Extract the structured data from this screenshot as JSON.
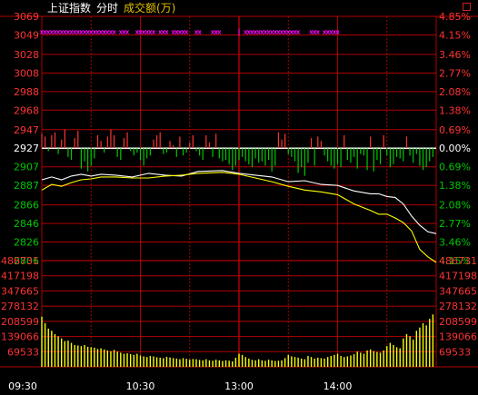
{
  "header": {
    "title": "上证指数",
    "mode": "分时",
    "series_label": "成交额(万)"
  },
  "colors": {
    "background": "#000000",
    "grid": "#b00000",
    "up": "#ff3333",
    "down": "#00c800",
    "neutral": "#ffffff",
    "index_line": "#ffffff",
    "average_line": "#ffff00",
    "volume": "#ffff00",
    "markers": "#ff00ff",
    "header_accent": "#e0c000"
  },
  "chart_data": {
    "type": "line",
    "title": "上证指数 分时",
    "ylabel_left": [
      "3069",
      "3049",
      "3028",
      "3008",
      "2988",
      "2968",
      "2947",
      "2927",
      "2907",
      "2887",
      "2866",
      "2846",
      "2826",
      "2806",
      "486731"
    ],
    "ylabel_right": [
      "4.85%",
      "4.15%",
      "3.46%",
      "2.77%",
      "2.08%",
      "1.38%",
      "0.69%",
      "0.00%",
      "0.69%",
      "1.38%",
      "2.08%",
      "2.77%",
      "3.46%",
      "4.15%",
      "486731"
    ],
    "price_ticks": [
      3069,
      3049,
      3028,
      3008,
      2988,
      2968,
      2947,
      2927,
      2907,
      2887,
      2866,
      2846,
      2826,
      2806
    ],
    "price_tick_status": [
      "up",
      "up",
      "up",
      "up",
      "up",
      "up",
      "up",
      "flat",
      "down",
      "down",
      "down",
      "down",
      "down",
      "down"
    ],
    "pct_ticks": [
      "4.85%",
      "4.15%",
      "3.46%",
      "2.77%",
      "2.08%",
      "1.38%",
      "0.69%",
      "0.00%",
      "0.69%",
      "1.38%",
      "2.08%",
      "2.77%",
      "3.46%",
      "4.15%"
    ],
    "base_price": 2927,
    "volume_ticks": [
      "486731",
      "417198",
      "347665",
      "278132",
      "208599",
      "139066",
      "69533"
    ],
    "volume_max": 486731,
    "x_tick_labels": [
      "09:30",
      "10:30",
      "13:00",
      "14:00"
    ],
    "x_tick_minutes": [
      0,
      60,
      120,
      180
    ],
    "total_minutes": 240,
    "series": [
      {
        "name": "index",
        "x": [
          0,
          6,
          12,
          18,
          24,
          30,
          36,
          45,
          55,
          65,
          75,
          85,
          95,
          110,
          120,
          130,
          140,
          150,
          160,
          170,
          180,
          190,
          200,
          205,
          210,
          215,
          220,
          225,
          230,
          235,
          240
        ],
        "values": [
          2893,
          2896,
          2893,
          2897,
          2899,
          2897,
          2899,
          2898,
          2896,
          2900,
          2898,
          2897,
          2902,
          2903,
          2900,
          2898,
          2896,
          2891,
          2892,
          2888,
          2887,
          2881,
          2878,
          2878,
          2875,
          2874,
          2867,
          2854,
          2844,
          2837,
          2835
        ]
      },
      {
        "name": "average",
        "x": [
          0,
          6,
          12,
          18,
          24,
          30,
          36,
          45,
          55,
          65,
          75,
          85,
          95,
          110,
          120,
          130,
          140,
          150,
          160,
          170,
          180,
          190,
          200,
          205,
          210,
          215,
          220,
          225,
          230,
          235,
          240
        ],
        "values": [
          2882,
          2888,
          2886,
          2890,
          2893,
          2894,
          2896,
          2896,
          2895,
          2895,
          2897,
          2898,
          2900,
          2901,
          2899,
          2895,
          2891,
          2886,
          2882,
          2880,
          2877,
          2867,
          2860,
          2856,
          2856,
          2852,
          2847,
          2838,
          2818,
          2810,
          2804
        ]
      }
    ],
    "minute_bars": {
      "x_start": 0,
      "x_step": 2,
      "values": [
        1,
        0.8,
        -0.2,
        0.9,
        1.1,
        -0.4,
        0.6,
        1.3,
        -0.6,
        -0.8,
        0.7,
        1.2,
        -1.4,
        -0.9,
        -1.6,
        -1.2,
        -0.7,
        0.9,
        0.5,
        -0.3,
        0.8,
        1.3,
        0.9,
        -0.6,
        -0.8,
        0.7,
        1.1,
        -0.2,
        -0.5,
        -0.3,
        -0.8,
        -1.2,
        -0.7,
        -0.5,
        0.6,
        0.9,
        1.1,
        -0.4,
        -0.3,
        0.5,
        0.2,
        -0.6,
        0.8,
        -0.5,
        -0.3,
        0.4,
        0.9,
        -0.2,
        -0.5,
        -0.8,
        0.9,
        0.4,
        -0.6,
        1.0,
        -0.7,
        -0.9,
        -0.8,
        -1.1,
        -1.5,
        -1.2,
        -0.8,
        -0.6,
        -0.9,
        -1.1,
        -1.3,
        -0.7,
        -1.0,
        -0.9,
        -1.2,
        -0.8,
        -1.6,
        -1.2,
        1.1,
        0.6,
        1.0,
        -0.4,
        -0.6,
        -0.9,
        -1.7,
        -1.3,
        -1.9,
        -1.0,
        0.7,
        -1.2,
        0.8,
        0.5,
        -0.5,
        -0.9,
        -1.2,
        -1.4,
        -1.1,
        -1.3,
        0.9,
        -0.8,
        -1.0,
        -0.6,
        -1.4,
        -0.4,
        -0.5,
        -1.5,
        0.8,
        -1.6,
        -0.8,
        -1.1,
        0.9,
        -0.5,
        -1.3,
        -1.1,
        -0.6,
        -0.7,
        -0.9,
        0.8,
        -0.5,
        -1.0,
        -0.4,
        -1.2,
        -1.5,
        -1.3,
        -0.9,
        -0.6
      ]
    },
    "volume_series": {
      "x_start": 0,
      "x_step": 2,
      "values": [
        230000,
        200000,
        175000,
        165000,
        150000,
        140000,
        130000,
        118000,
        120000,
        110000,
        100000,
        98000,
        95000,
        100000,
        92000,
        90000,
        88000,
        82000,
        85000,
        80000,
        75000,
        72000,
        78000,
        70000,
        65000,
        60000,
        62000,
        58000,
        55000,
        60000,
        52000,
        48000,
        45000,
        50000,
        48000,
        44000,
        42000,
        40000,
        46000,
        43000,
        40000,
        38000,
        35000,
        40000,
        37000,
        33000,
        36000,
        35000,
        32000,
        30000,
        35000,
        30000,
        28000,
        33000,
        30000,
        27000,
        30000,
        28000,
        25000,
        42000,
        60000,
        55000,
        45000,
        38000,
        32000,
        30000,
        35000,
        30000,
        28000,
        33000,
        30000,
        27000,
        28000,
        30000,
        40000,
        55000,
        48000,
        45000,
        42000,
        38000,
        35000,
        50000,
        45000,
        38000,
        42000,
        40000,
        38000,
        45000,
        50000,
        55000,
        60000,
        50000,
        45000,
        48000,
        52000,
        58000,
        70000,
        65000,
        60000,
        75000,
        80000,
        72000,
        68000,
        65000,
        75000,
        95000,
        110000,
        100000,
        90000,
        85000,
        130000,
        150000,
        140000,
        125000,
        165000,
        180000,
        200000,
        190000,
        220000,
        240000
      ]
    },
    "marker_row": {
      "minute_ranges": [
        [
          0,
          44
        ],
        [
          48,
          52
        ],
        [
          58,
          62
        ],
        [
          64,
          68
        ],
        [
          72,
          76
        ],
        [
          80,
          84
        ],
        [
          86,
          88
        ],
        [
          94,
          96
        ],
        [
          104,
          108
        ],
        [
          124,
          156
        ],
        [
          164,
          168
        ],
        [
          172,
          180
        ]
      ],
      "tick_minute": 120
    },
    "ylim": [
      2806,
      3069
    ],
    "grid": true
  }
}
